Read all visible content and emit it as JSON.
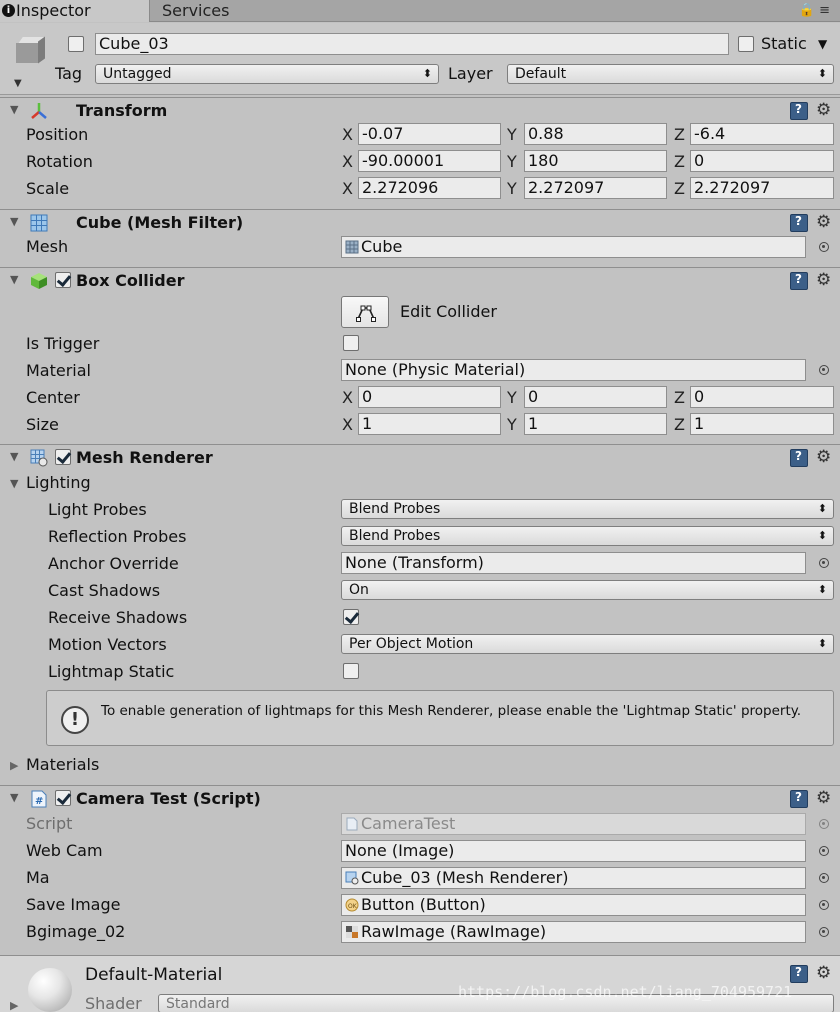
{
  "tabs": {
    "inspector": "Inspector",
    "services": "Services"
  },
  "header": {
    "object_name": "Cube_03",
    "static_label": "Static",
    "tag_label": "Tag",
    "tag_value": "Untagged",
    "layer_label": "Layer",
    "layer_value": "Default"
  },
  "transform": {
    "title": "Transform",
    "position_label": "Position",
    "rotation_label": "Rotation",
    "scale_label": "Scale",
    "axis_x": "X",
    "axis_y": "Y",
    "axis_z": "Z",
    "position": {
      "x": "-0.07",
      "y": "0.88",
      "z": "-6.4"
    },
    "rotation": {
      "x": "-90.00001",
      "y": "180",
      "z": "0"
    },
    "scale": {
      "x": "2.272096",
      "y": "2.272097",
      "z": "2.272097"
    }
  },
  "mesh_filter": {
    "title": "Cube (Mesh Filter)",
    "mesh_label": "Mesh",
    "mesh_value": "Cube"
  },
  "box_collider": {
    "title": "Box Collider",
    "enabled": true,
    "edit_collider": "Edit Collider",
    "is_trigger_label": "Is Trigger",
    "is_trigger": false,
    "material_label": "Material",
    "material_value": "None (Physic Material)",
    "center_label": "Center",
    "size_label": "Size",
    "center": {
      "x": "0",
      "y": "0",
      "z": "0"
    },
    "size": {
      "x": "1",
      "y": "1",
      "z": "1"
    }
  },
  "mesh_renderer": {
    "title": "Mesh Renderer",
    "enabled": true,
    "lighting_label": "Lighting",
    "light_probes_label": "Light Probes",
    "light_probes_value": "Blend Probes",
    "reflection_probes_label": "Reflection Probes",
    "reflection_probes_value": "Blend Probes",
    "anchor_override_label": "Anchor Override",
    "anchor_override_value": "None (Transform)",
    "cast_shadows_label": "Cast Shadows",
    "cast_shadows_value": "On",
    "receive_shadows_label": "Receive Shadows",
    "receive_shadows": true,
    "motion_vectors_label": "Motion Vectors",
    "motion_vectors_value": "Per Object Motion",
    "lightmap_static_label": "Lightmap Static",
    "lightmap_static": false,
    "helpbox_text": "To enable generation of lightmaps for this Mesh Renderer, please enable the 'Lightmap Static' property.",
    "materials_label": "Materials"
  },
  "camera_test": {
    "title": "Camera Test (Script)",
    "enabled": true,
    "script_label": "Script",
    "script_value": "CameraTest",
    "web_cam_label": "Web Cam",
    "web_cam_value": "None (Image)",
    "ma_label": "Ma",
    "ma_value": "Cube_03 (Mesh Renderer)",
    "save_image_label": "Save Image",
    "save_image_value": "Button (Button)",
    "bgimage_label": "Bgimage_02",
    "bgimage_value": "RawImage (RawImage)"
  },
  "material": {
    "name": "Default-Material",
    "shader_label": "Shader",
    "shader_value": "Standard"
  },
  "watermark": "https://blog.csdn.net/liang_704959721",
  "colors": {
    "panel": "#c2c2c2",
    "field": "#ebebeb",
    "help_icon": "#3c5f88"
  }
}
